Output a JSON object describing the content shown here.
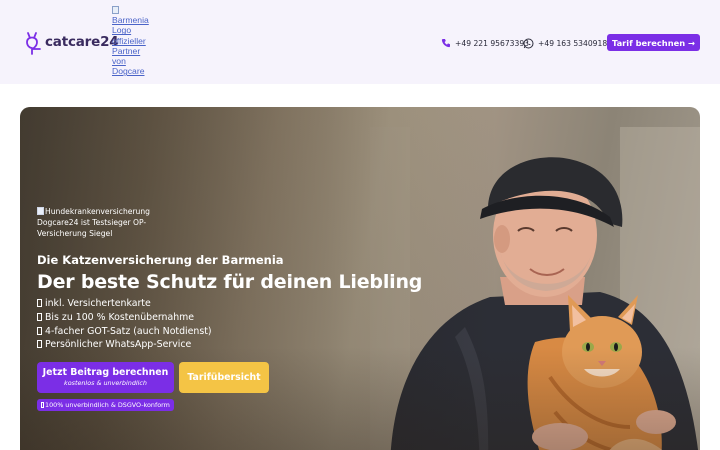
{
  "header": {
    "logo_text": "catcare24",
    "partner_alt": "Barmenia Logo offizieller Partner von Dogcare",
    "phone1": "+49 221 95673393",
    "phone2": "+49 163 5340918",
    "cta_label": "Tarif berechnen →"
  },
  "hero": {
    "siegel_alt": "Hundekrankenversicherung Dogcare24 ist Testsieger OP-Versicherung Siegel",
    "subtitle": "Die Katzenversicherung der Barmenia",
    "title": "Der beste Schutz für deinen Liebling",
    "features": [
      "inkl. Versichertenkarte",
      "Bis zu 100 % Kostenübernahme",
      "4-facher GOT-Satz (auch Notdienst)",
      "Persönlicher WhatsApp-Service"
    ],
    "cta_main": "Jetzt Beitrag berechnen",
    "cta_main_sub": "kostenlos & unverbindlich",
    "cta_second": "Tarifübersicht",
    "badge": "100% unverbindlich & DSGVO-konform"
  },
  "colors": {
    "brand_purple": "#7b2ee6",
    "cta_yellow": "#f4c445",
    "header_bg": "#f6f3fc"
  },
  "icons": [
    "logo-cat-mark-icon",
    "phone-icon",
    "whatsapp-icon",
    "check-icon"
  ]
}
